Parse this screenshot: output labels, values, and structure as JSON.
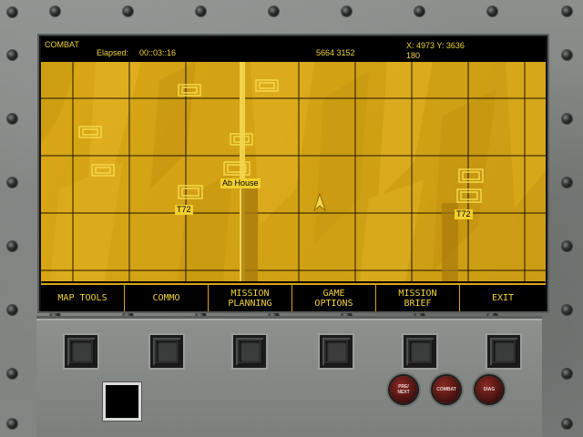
{
  "status": {
    "mode": "COMBAT",
    "elapsed_label": "Elapsed:",
    "elapsed_value": "00::03::16",
    "grid_ref": "5664  3152",
    "coords": "X: 4973 Y: 3636",
    "heading": "180"
  },
  "map": {
    "labels": [
      {
        "text": "Ab House"
      },
      {
        "text": "T72"
      },
      {
        "text": "T72"
      }
    ]
  },
  "menu": {
    "items": [
      {
        "label": "MAP TOOLS"
      },
      {
        "label": "COMMO"
      },
      {
        "label": "MISSION\nPLANNING"
      },
      {
        "label": "GAME\nOPTIONS"
      },
      {
        "label": "MISSION\nBRIEF"
      },
      {
        "label": "EXIT"
      }
    ]
  },
  "panel": {
    "round_buttons": [
      {
        "label": "PRE/\nNEXT"
      },
      {
        "label": "COMBAT"
      },
      {
        "label": "DIAG"
      }
    ]
  },
  "colors": {
    "hud_text": "#f1d23a",
    "map_fill": "#d8a615",
    "map_grid": "#000000"
  }
}
